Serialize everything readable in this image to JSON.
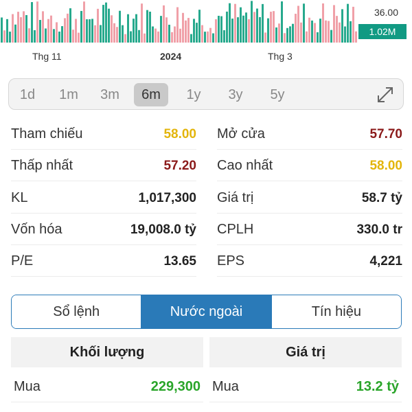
{
  "chart": {
    "price_label": "36.00",
    "volume_label": "1.02M",
    "x_labels": [
      "Thg 11",
      "2024",
      "Thg 3"
    ],
    "colors": {
      "up": "#27a98d",
      "down": "#f0a0a8"
    }
  },
  "range": {
    "options": [
      "1d",
      "1m",
      "3m",
      "6m",
      "1y",
      "3y",
      "5y"
    ],
    "selected": "6m"
  },
  "stats": [
    {
      "label": "Tham chiếu",
      "value": "58.00",
      "color": "yellow"
    },
    {
      "label": "Mở cửa",
      "value": "57.70",
      "color": "red"
    },
    {
      "label": "Thấp nhất",
      "value": "57.20",
      "color": "red"
    },
    {
      "label": "Cao nhất",
      "value": "58.00",
      "color": "yellow"
    },
    {
      "label": "KL",
      "value": "1,017,300",
      "color": "default"
    },
    {
      "label": "Giá trị",
      "value": "58.7 tỷ",
      "color": "default"
    },
    {
      "label": "Vốn hóa",
      "value": "19,008.0 tỷ",
      "color": "default"
    },
    {
      "label": "CPLH",
      "value": "330.0 tr",
      "color": "default"
    },
    {
      "label": "P/E",
      "value": "13.65",
      "color": "default"
    },
    {
      "label": "EPS",
      "value": "4,221",
      "color": "default"
    }
  ],
  "tabs": {
    "items": [
      "Sổ lệnh",
      "Nước ngoài",
      "Tín hiệu"
    ],
    "active": "Nước ngoài"
  },
  "foreign": {
    "volume_header": "Khối lượng",
    "value_header": "Giá trị",
    "buy_label": "Mua",
    "buy_volume": "229,300",
    "buy_value": "13.2 tỷ",
    "value_color": "#2aa52a"
  }
}
